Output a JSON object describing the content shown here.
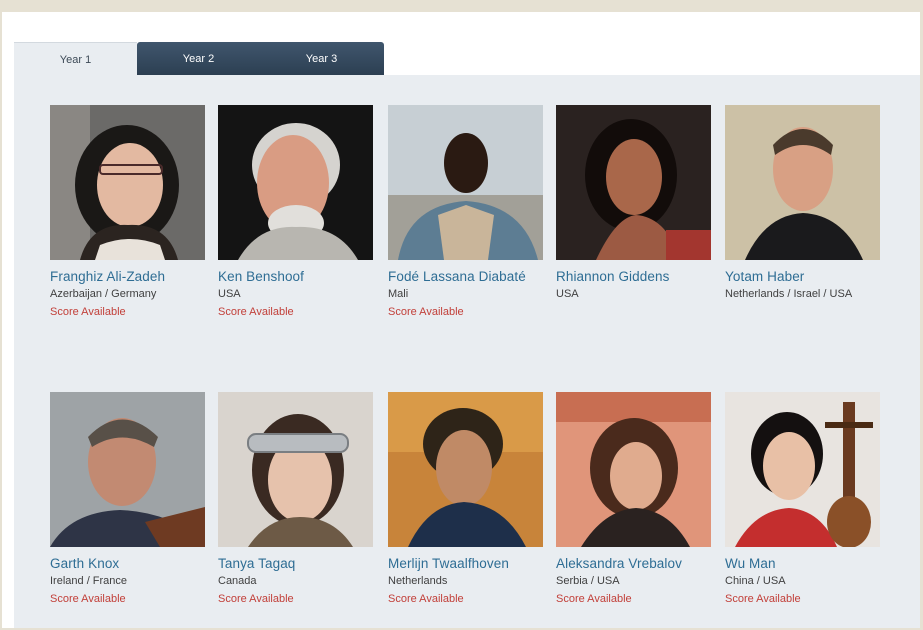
{
  "tabs": [
    "Year 1",
    "Year 2",
    "Year 3"
  ],
  "composers": [
    {
      "name": "Franghiz Ali-Zadeh",
      "country": "Azerbaijan / Germany",
      "score": "Score Available"
    },
    {
      "name": "Ken Benshoof",
      "country": "USA",
      "score": "Score Available"
    },
    {
      "name": "Fodé Lassana Diabaté",
      "country": "Mali",
      "score": "Score Available"
    },
    {
      "name": "Rhiannon Giddens",
      "country": "USA",
      "score": ""
    },
    {
      "name": "Yotam Haber",
      "country": "Netherlands / Israel / USA",
      "score": ""
    },
    {
      "name": "Garth Knox",
      "country": "Ireland / France",
      "score": "Score Available"
    },
    {
      "name": "Tanya Tagaq",
      "country": "Canada",
      "score": "Score Available"
    },
    {
      "name": "Merlijn Twaalfhoven",
      "country": "Netherlands",
      "score": "Score Available"
    },
    {
      "name": "Aleksandra Vrebalov",
      "country": "Serbia / USA",
      "score": "Score Available"
    },
    {
      "name": "Wu Man",
      "country": "China / USA",
      "score": "Score Available"
    }
  ]
}
